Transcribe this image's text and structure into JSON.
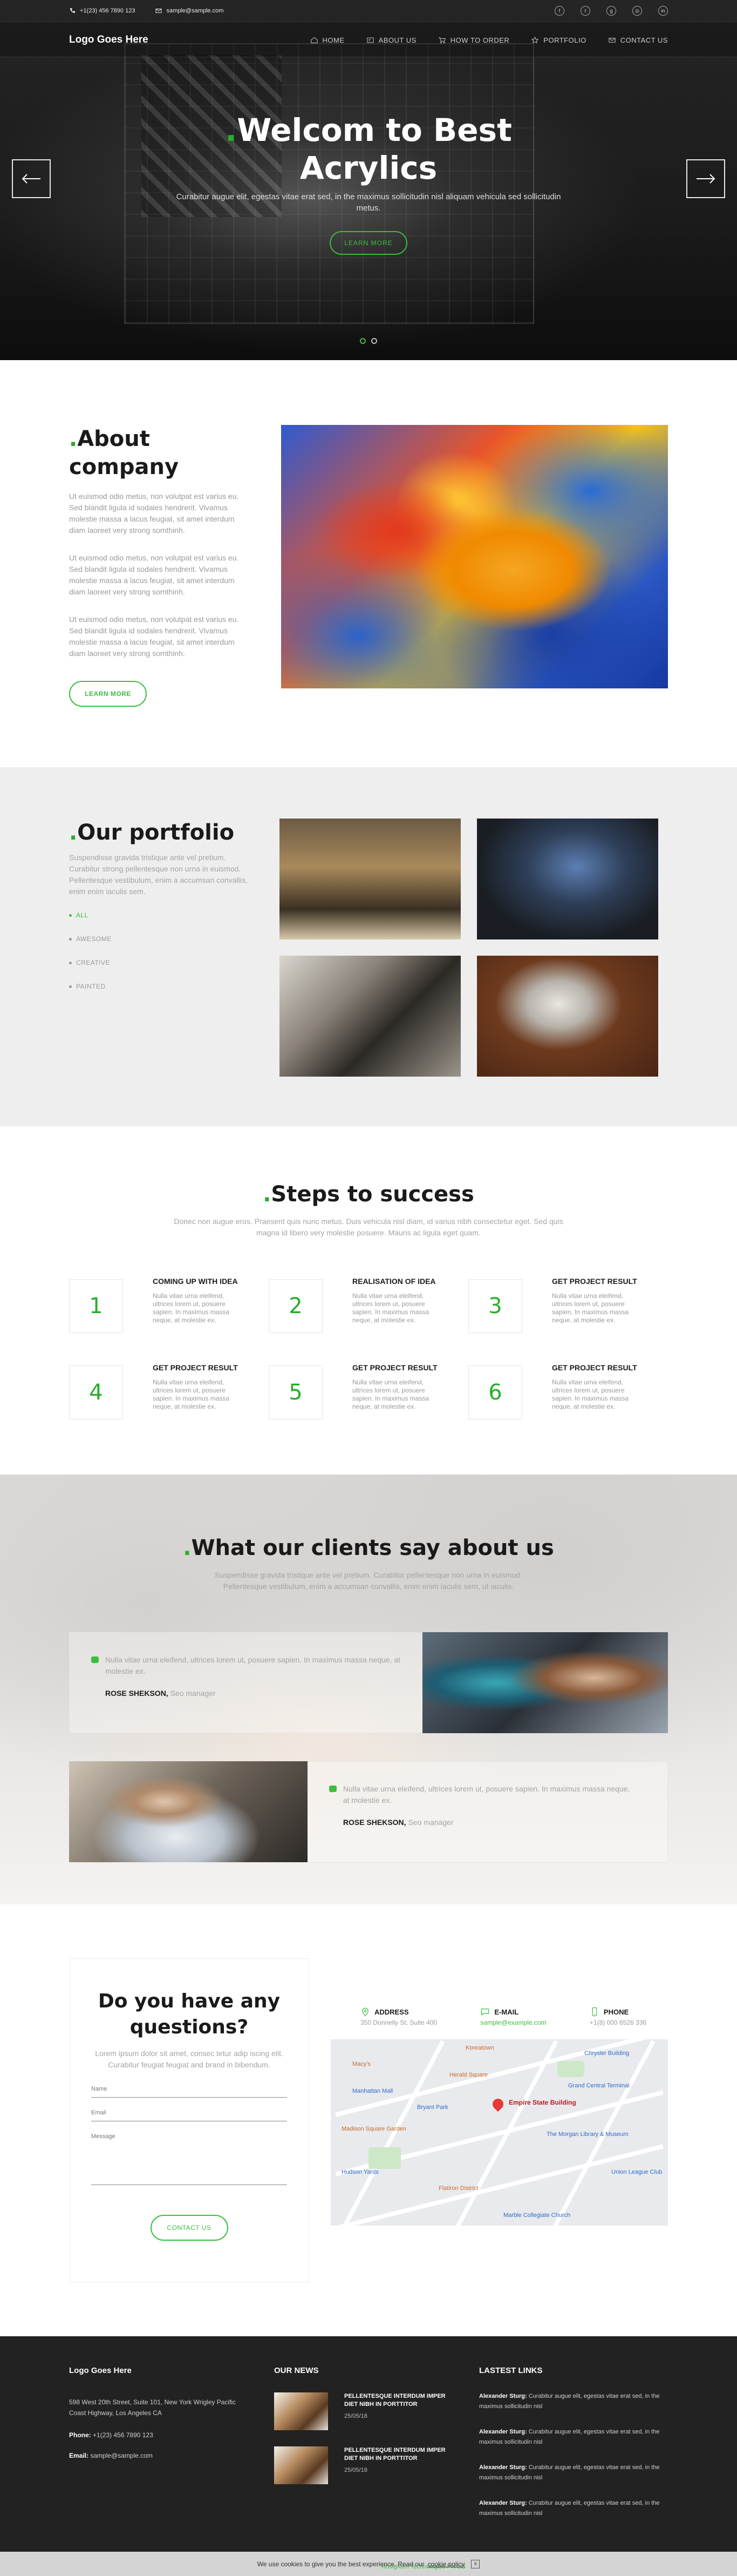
{
  "topbar": {
    "phone": "+1(23) 456 7890 123",
    "email": "sample@sample.com",
    "socials": [
      "facebook-icon",
      "twitter-icon",
      "google-plus-icon",
      "instagram-icon",
      "linkedin-icon"
    ]
  },
  "nav": {
    "logo": "Logo Goes Here",
    "items": [
      {
        "label": "HOME",
        "icon": "home-icon"
      },
      {
        "label": "ABOUT US",
        "icon": "card-icon"
      },
      {
        "label": "HOW TO ORDER",
        "icon": "cart-icon"
      },
      {
        "label": "PORTFOLIO",
        "icon": "star-icon"
      },
      {
        "label": "CONTACT US",
        "icon": "mail-icon"
      }
    ]
  },
  "hero": {
    "title": "Welcom to Best Acrylics",
    "subtitle": "Curabitur augue elit, egestas vitae erat sed, in the maximus sollicitudin nisl aliquam vehicula sed sollicitudin metus.",
    "button": "LEARN MORE",
    "slides_total": 2,
    "active_slide": 1
  },
  "about": {
    "title": "About company",
    "paragraphs": [
      "Ut euismod odio metus, non volutpat est varius eu. Sed blandit ligula id sodales hendrerit. Vivamus molestie massa a lacus feugiat, sit amet interdum diam laoreet very strong somthinh.",
      "Ut euismod odio metus, non volutpat est varius eu. Sed blandit ligula id sodales hendrerit. Vivamus molestie massa a lacus feugiat, sit amet interdum diam laoreet very strong somthinh.",
      "Ut euismod odio metus, non volutpat est varius eu. Sed blandit ligula id sodales hendrerit. Vivamus molestie massa a lacus feugiat, sit amet interdum diam laoreet very strong somthinh."
    ],
    "button": "LEARN MORE"
  },
  "portfolio": {
    "title": "Our portfolio",
    "text": "Suspendisse gravida tristique ante vel pretium. Curabitur strong pellentesque non urna in euismod. Pellentesque vestibulum, enim a accumsan convallis, enim enim iaculis sem.",
    "filters": [
      {
        "label": "ALL",
        "active": true
      },
      {
        "label": "AWESOME",
        "active": false
      },
      {
        "label": "CREATIVE",
        "active": false
      },
      {
        "label": "PAINTED",
        "active": false
      }
    ]
  },
  "steps": {
    "title": "Steps to success",
    "text": "Donec non augue eros. Praesent quis nunc metus. Duis vehicula nisl diam, id varius nibh consectetur eget. Sed quis magna id libero very molestie posuere. Mauris ac ligula eget quam.",
    "items": [
      {
        "num": "1",
        "title": "COMING UP WITH IDEA",
        "text": "Nulla vitae urna eleifend, ultrices lorem ut, posuere sapien. In maximus massa neque, at molestie ex."
      },
      {
        "num": "2",
        "title": "REALISATION OF IDEA",
        "text": "Nulla vitae urna eleifend, ultrices lorem ut, posuere sapien. In maximus massa neque, at molestie ex."
      },
      {
        "num": "3",
        "title": "GET PROJECT RESULT",
        "text": "Nulla vitae urna eleifend, ultrices lorem ut, posuere sapien. In maximus massa neque, at molestie ex."
      },
      {
        "num": "4",
        "title": "GET PROJECT RESULT",
        "text": "Nulla vitae urna eleifend, ultrices lorem ut, posuere sapien. In maximus massa neque, at molestie ex."
      },
      {
        "num": "5",
        "title": "GET PROJECT RESULT",
        "text": "Nulla vitae urna eleifend, ultrices lorem ut, posuere sapien. In maximus massa neque, at molestie ex."
      },
      {
        "num": "6",
        "title": "GET PROJECT RESULT",
        "text": "Nulla vitae urna eleifend, ultrices lorem ut, posuere sapien. In maximus massa neque, at molestie ex."
      }
    ]
  },
  "testimonials": {
    "title": "What our clients say about us",
    "text": "Suspendisse gravida tristique ante vel pretium. Curabitur pellentesque non urna in euismod. Pellentesque vestibulum, enim a accumsan convallis, enim enim iaculis sem, ut iaculis.",
    "items": [
      {
        "quote": "Nulla vitae urna eleifend, ultrices lorem ut, posuere sapien. In maximus massa neque, at molestie ex.",
        "name": "ROSE SHEKSON,",
        "role": "Seo manager"
      },
      {
        "quote": "Nulla vitae urna eleifend, ultrices lorem ut, posuere sapien. In maximus massa neque, at molestie ex.",
        "name": "ROSE SHEKSON,",
        "role": "Seo manager"
      }
    ]
  },
  "contact": {
    "title": "Do you have any questions?",
    "text": "Lorem ipsum dolor sit amet, consec tetur adip iscing elit. Curabitur feugiat feugiat and brand in bibendum.",
    "name_placeholder": "Name",
    "email_placeholder": "Email",
    "message_placeholder": "Message",
    "button": "CONTACT US",
    "address_label": "ADDRESS",
    "address_value": "350 Donnelly St, Suite 400",
    "email_label": "E-MAIL",
    "email_value": "sample@example.com",
    "phone_label": "PHONE",
    "phone_value": "+1(8) 000 6526 336",
    "map": {
      "pin_label": "Empire State Building",
      "pois": [
        "Koreatown",
        "Macy's",
        "Manhattan Mall",
        "Bryant Park",
        "Chrysler Building",
        "Grand Central Terminal",
        "The Morgan Library & Museum",
        "Madison Square Garden",
        "Union League Club",
        "Marble Collegiate Church",
        "Flatiron District",
        "Hudson Yards",
        "Herald Square"
      ]
    }
  },
  "footer": {
    "logo": "Logo Goes Here",
    "address": "598 West 20th Street, Suite 101, New York Wrigley Pacific Coast Highway, Los Angeles CA",
    "phone_label": "Phone:",
    "phone": "+1(23) 456 7890 123",
    "email_label": "Email:",
    "email": "sample@sample.com",
    "news_title": "OUR NEWS",
    "news": [
      {
        "title": "PELLENTESQUE INTERDUM IMPER DIET NIBH IN PORTTITOR",
        "date": "25/05/18"
      },
      {
        "title": "PELLENTESQUE INTERDUM IMPER DIET NIBH IN PORTTITOR",
        "date": "25/05/18"
      }
    ],
    "links_title": "LASTEST LINKS",
    "links": [
      {
        "author": "Alexander Sturg:",
        "text": "Curabitur augue elit, egestas vitae erat sed, in the maximus sollicitudin nisl"
      },
      {
        "author": "Alexander Sturg:",
        "text": "Curabitur augue elit, egestas vitae erat sed, in the maximus sollicitudin nisl"
      },
      {
        "author": "Alexander Sturg:",
        "text": "Curabitur augue elit, egestas vitae erat sed, in the maximus sollicitudin nisl"
      },
      {
        "author": "Alexander Sturg:",
        "text": "Curabitur augue elit, egestas vitae erat sed, in the maximus sollicitudin nisl"
      }
    ],
    "copyright": "2018 All rights reserved. Development by",
    "developer": "Hostgreen Technologies Pvt Ltd"
  },
  "cookie": {
    "text": "We use cookies to give you the best experience. Read our",
    "link": "cookie policy",
    "close": "x"
  },
  "colors": {
    "accent": "#3bbf3f",
    "footer_bg": "#222222",
    "portfolio_bg": "#eeeeee"
  }
}
